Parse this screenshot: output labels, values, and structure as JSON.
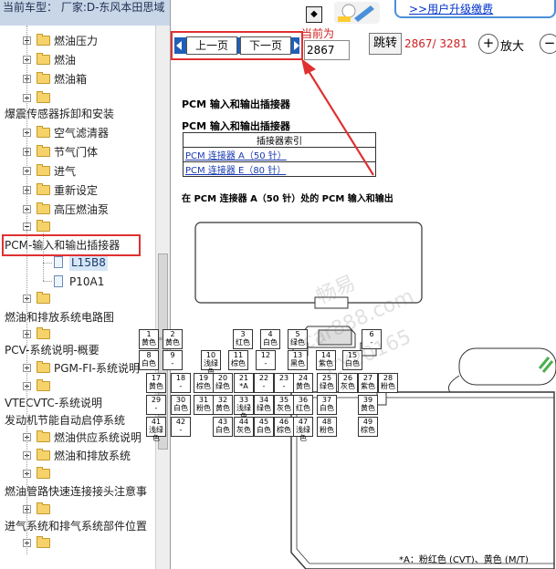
{
  "title": "当前车型：  厂家:D-东风本田思域（CIVIC）2016-2017",
  "tree": [
    {
      "label": "燃油压力",
      "type": "folder"
    },
    {
      "label": "燃油",
      "type": "folder"
    },
    {
      "label": "燃油箱",
      "type": "folder"
    },
    {
      "label": "",
      "type": "folder"
    },
    {
      "label": "爆震传感器拆卸和安装",
      "type": "heading"
    },
    {
      "label": "空气滤清器",
      "type": "folder"
    },
    {
      "label": "节气门体",
      "type": "folder"
    },
    {
      "label": "进气",
      "type": "folder"
    },
    {
      "label": "重新设定",
      "type": "folder"
    },
    {
      "label": "高压燃油泵",
      "type": "folder"
    },
    {
      "label": "",
      "type": "folder"
    },
    {
      "label": "PCM-输入和输出插接器",
      "type": "heading"
    },
    {
      "label": "L15B8",
      "type": "doc"
    },
    {
      "label": "P10A1",
      "type": "doc"
    },
    {
      "label": "",
      "type": "folder"
    },
    {
      "label": "燃油和排放系统电路图",
      "type": "heading"
    },
    {
      "label": "",
      "type": "folder"
    },
    {
      "label": "PCV-系统说明-概要",
      "type": "heading"
    },
    {
      "label": "PGM-FI-系统说明",
      "type": "folder"
    },
    {
      "label": "",
      "type": "folder"
    },
    {
      "label": "VTECVTC-系统说明",
      "type": "heading"
    },
    {
      "label": "发动机节能自动启停系统",
      "type": "heading"
    },
    {
      "label": "燃油供应系统说明",
      "type": "folder"
    },
    {
      "label": "燃油和排放系统",
      "type": "folder"
    },
    {
      "label": "",
      "type": "folder"
    },
    {
      "label": "燃油管路快速连接接头注意事",
      "type": "heading"
    },
    {
      "label": "",
      "type": "folder"
    },
    {
      "label": "进气系统和排气系统部件位置",
      "type": "heading"
    },
    {
      "label": "",
      "type": "folder"
    }
  ],
  "toolbar": {
    "upgrade": ">>用户升级缴费",
    "prev": "上一页",
    "next": "下一页",
    "current_label": "当前为",
    "page_value": "2867",
    "goto": "跳转",
    "pagecount": "2867/ 3281",
    "zoom_in": "放大",
    "zoom_in_symbol": "+",
    "zoom_out_symbol": "−"
  },
  "doc": {
    "title": "PCM 输入和输出插接器",
    "subtitle": "PCM 输入和输出插接器",
    "table_header": "插接器索引",
    "rows": [
      "PCM 连接器 A（50 针）",
      "PCM 连接器 E（80 针）"
    ],
    "section": "在  PCM 连接器  A（50 针）处的  PCM 输入和输出",
    "footnote": "*A：粉红色 (CVT)、黄色 (M/T)",
    "watermark1": "畅易",
    "watermark2": "car888.com",
    "watermark3": "CY20165"
  },
  "pins": [
    {
      "n": "1",
      "c": "黄色"
    },
    {
      "n": "2",
      "c": "黄色"
    },
    {
      "n": "3",
      "c": "红色"
    },
    {
      "n": "4",
      "c": "白色"
    },
    {
      "n": "5",
      "c": "绿色"
    },
    {
      "n": "6",
      "c": "-"
    },
    {
      "n": "8",
      "c": "白色"
    },
    {
      "n": "9",
      "c": "-"
    },
    {
      "n": "10",
      "c": "浅绿色"
    },
    {
      "n": "11",
      "c": "棕色"
    },
    {
      "n": "12",
      "c": "-"
    },
    {
      "n": "13",
      "c": "黑色"
    },
    {
      "n": "14",
      "c": "紫色"
    },
    {
      "n": "15",
      "c": "白色"
    },
    {
      "n": "17",
      "c": "黄色"
    },
    {
      "n": "18",
      "c": "-"
    },
    {
      "n": "19",
      "c": "棕色"
    },
    {
      "n": "20",
      "c": "绿色"
    },
    {
      "n": "21",
      "c": "*A"
    },
    {
      "n": "22",
      "c": "-"
    },
    {
      "n": "23",
      "c": "-"
    },
    {
      "n": "24",
      "c": "黄色"
    },
    {
      "n": "25",
      "c": "绿色"
    },
    {
      "n": "26",
      "c": "灰色"
    },
    {
      "n": "27",
      "c": "紫色"
    },
    {
      "n": "28",
      "c": "粉色"
    },
    {
      "n": "29",
      "c": "-"
    },
    {
      "n": "30",
      "c": "白色"
    },
    {
      "n": "31",
      "c": "粉色"
    },
    {
      "n": "32",
      "c": "黄色"
    },
    {
      "n": "33",
      "c": "浅绿色"
    },
    {
      "n": "34",
      "c": "绿色"
    },
    {
      "n": "35",
      "c": "灰色"
    },
    {
      "n": "36",
      "c": "红色"
    },
    {
      "n": "37",
      "c": "白色"
    },
    {
      "n": "39",
      "c": "黄色"
    },
    {
      "n": "41",
      "c": "浅绿色"
    },
    {
      "n": "42",
      "c": "-"
    },
    {
      "n": "43",
      "c": "白色"
    },
    {
      "n": "44",
      "c": "灰色"
    },
    {
      "n": "45",
      "c": "白色"
    },
    {
      "n": "46",
      "c": "棕色"
    },
    {
      "n": "47",
      "c": "浅绿色"
    },
    {
      "n": "48",
      "c": "粉色"
    },
    {
      "n": "49",
      "c": "棕色"
    }
  ]
}
